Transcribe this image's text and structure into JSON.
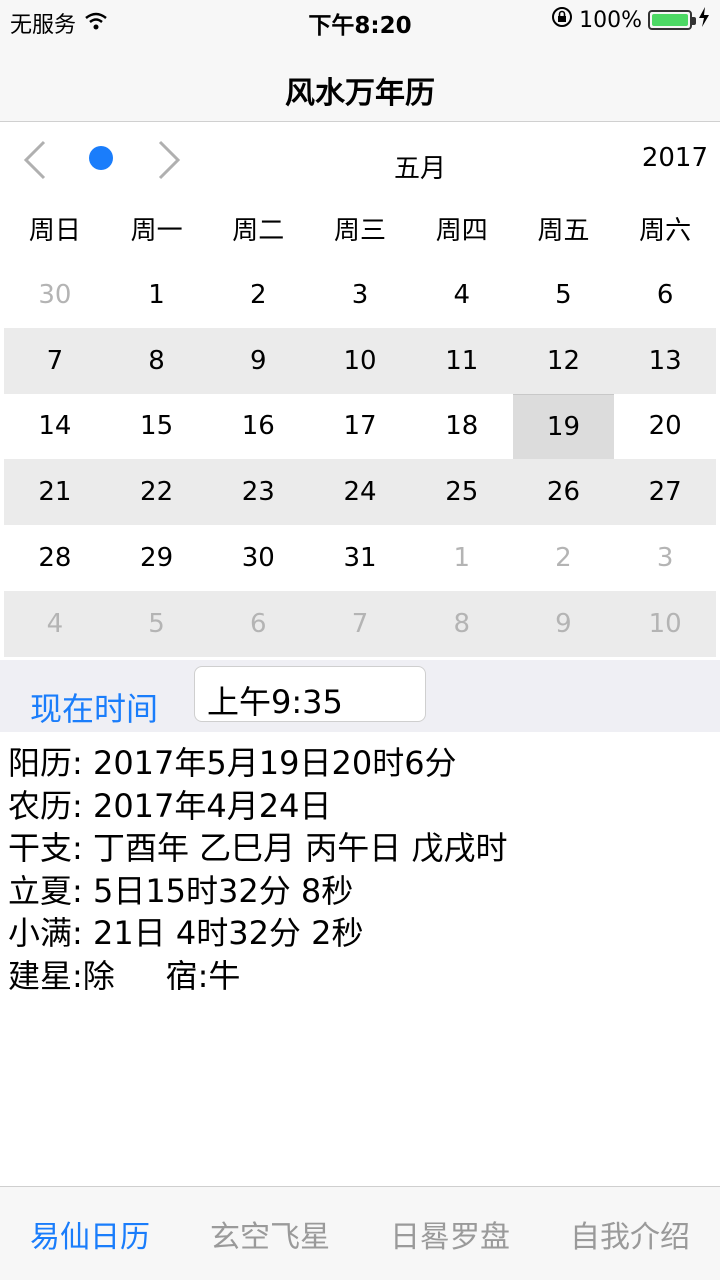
{
  "status": {
    "carrier": "无服务",
    "time": "下午8:20",
    "battery": "100%",
    "accent_battery": "#4cd964"
  },
  "nav": {
    "title": "风水万年历"
  },
  "calendar": {
    "month": "五月",
    "year": "2017",
    "weekdays": [
      "周日",
      "周一",
      "周二",
      "周三",
      "周四",
      "周五",
      "周六"
    ],
    "weeks": [
      [
        "30",
        "1",
        "2",
        "3",
        "4",
        "5",
        "6"
      ],
      [
        "7",
        "8",
        "9",
        "10",
        "11",
        "12",
        "13"
      ],
      [
        "14",
        "15",
        "16",
        "17",
        "18",
        "19",
        "20"
      ],
      [
        "21",
        "22",
        "23",
        "24",
        "25",
        "26",
        "27"
      ],
      [
        "28",
        "29",
        "30",
        "31",
        "1",
        "2",
        "3"
      ],
      [
        "4",
        "5",
        "6",
        "7",
        "8",
        "9",
        "10"
      ]
    ],
    "selected": "19",
    "accent": "#1a7dfb"
  },
  "time": {
    "label": "现在时间",
    "value": "上午9:35"
  },
  "info": {
    "solar": "阳历: 2017年5月19日20时6分",
    "lunar": "农历: 2017年4月24日",
    "ganzhi": "干支: 丁酉年 乙巳月 丙午日 戊戌时",
    "lixia": "立夏: 5日15时32分 8秒",
    "xiaoman": "小满: 21日 4时32分 2秒",
    "jianxing": "建星:除     宿:牛"
  },
  "tabs": [
    "易仙日历",
    "玄空飞星",
    "日晷罗盘",
    "自我介绍"
  ]
}
